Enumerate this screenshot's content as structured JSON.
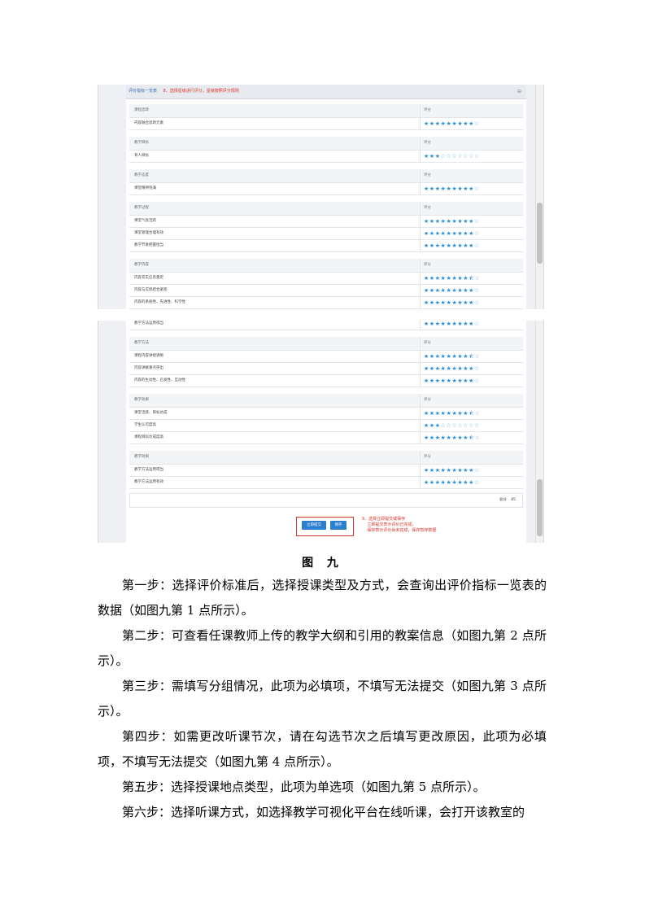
{
  "panel": {
    "title": "评价指标一览表",
    "note": "8、选择星级进行评分，星级按照评分规则",
    "collapse_icon": "minus-icon"
  },
  "shot1_rows": [
    {
      "type": "cat",
      "label": "课程思政",
      "cell": "评分"
    },
    {
      "type": "item",
      "label": "内容融合思政元素",
      "stars": 9
    },
    {
      "type": "cat",
      "label": "教学目标",
      "cell": "评分"
    },
    {
      "type": "item",
      "label": "育人目标",
      "stars": 3
    },
    {
      "type": "cat",
      "label": "教学态度",
      "cell": "评分"
    },
    {
      "type": "item",
      "label": "课堂精神饱满",
      "stars": 9
    },
    {
      "type": "cat",
      "label": "教学过程",
      "cell": "评分"
    },
    {
      "type": "item",
      "label": "课堂气氛活跃",
      "stars": 9
    },
    {
      "type": "item",
      "label": "课堂管理合理有效",
      "stars": 9
    },
    {
      "type": "item",
      "label": "教学节奏把握恰当",
      "stars": 9
    },
    {
      "type": "cat",
      "label": "教学内容",
      "cell": "评分"
    },
    {
      "type": "item",
      "label": "内容充实信息量足",
      "stars": 8.5
    },
    {
      "type": "item",
      "label": "内容与实际结合紧密",
      "stars": 9
    },
    {
      "type": "item",
      "label": "内容的系统性、先进性、科学性",
      "stars": 9
    }
  ],
  "shot2_rows": [
    {
      "type": "item",
      "label": "教学方法运用得当",
      "stars": 9
    },
    {
      "type": "cat",
      "label": "教学方法",
      "cell": "评分"
    },
    {
      "type": "item",
      "label": "课程内容讲授清晰",
      "stars": 8.5
    },
    {
      "type": "item",
      "label": "内容讲解重点突出",
      "stars": 9
    },
    {
      "type": "item",
      "label": "内容的生动性、启发性、互动性",
      "stars": 9
    },
    {
      "type": "cat",
      "label": "教学效果",
      "cell": "评分"
    },
    {
      "type": "item",
      "label": "课堂活跃、目标达成",
      "stars": 8.5
    },
    {
      "type": "item",
      "label": "学生认可度高",
      "stars": 3
    },
    {
      "type": "item",
      "label": "课程目标达成度高",
      "stars": 8.5
    },
    {
      "type": "cat",
      "label": "教学效果",
      "cell": "评分"
    },
    {
      "type": "item",
      "label": "教学方法运用得当",
      "stars": 9
    },
    {
      "type": "item",
      "label": "教学方法运用有效",
      "stars": 9
    }
  ],
  "total": {
    "label": "总分",
    "value": "85"
  },
  "buttons": {
    "submit": "立即提交",
    "save": "保存"
  },
  "annotation": "9、选择立即提交或保存\n    立即提交表示评价已完成，\n    保存表示评价尚未完成，保存暂存数据",
  "figure_caption": "图 九",
  "paragraphs": [
    "第一步：选择评价标准后，选择授课类型及方式，会查询出评价指标一览表的数据（如图九第 1 点所示）。",
    "第二步：可查看任课教师上传的教学大纲和引用的教案信息（如图九第 2 点所示）。",
    "第三步：需填写分组情况，此项为必填项，不填写无法提交（如图九第 3 点所示）。",
    "第四步：如需更改听课节次，请在勾选节次之后填写更改原因，此项为必填项，不填写无法提交（如图九第 4 点所示）。",
    "第五步：选择授课地点类型，此项为单选项（如图九第 5 点所示）。",
    "第六步：选择听课方式，如选择教学可视化平台在线听课，会打开该教室的"
  ],
  "colors": {
    "star": "#2b8fd8",
    "header_title": "#3b6db3",
    "annotation": "#d9342b",
    "button": "#2a7fcf"
  }
}
